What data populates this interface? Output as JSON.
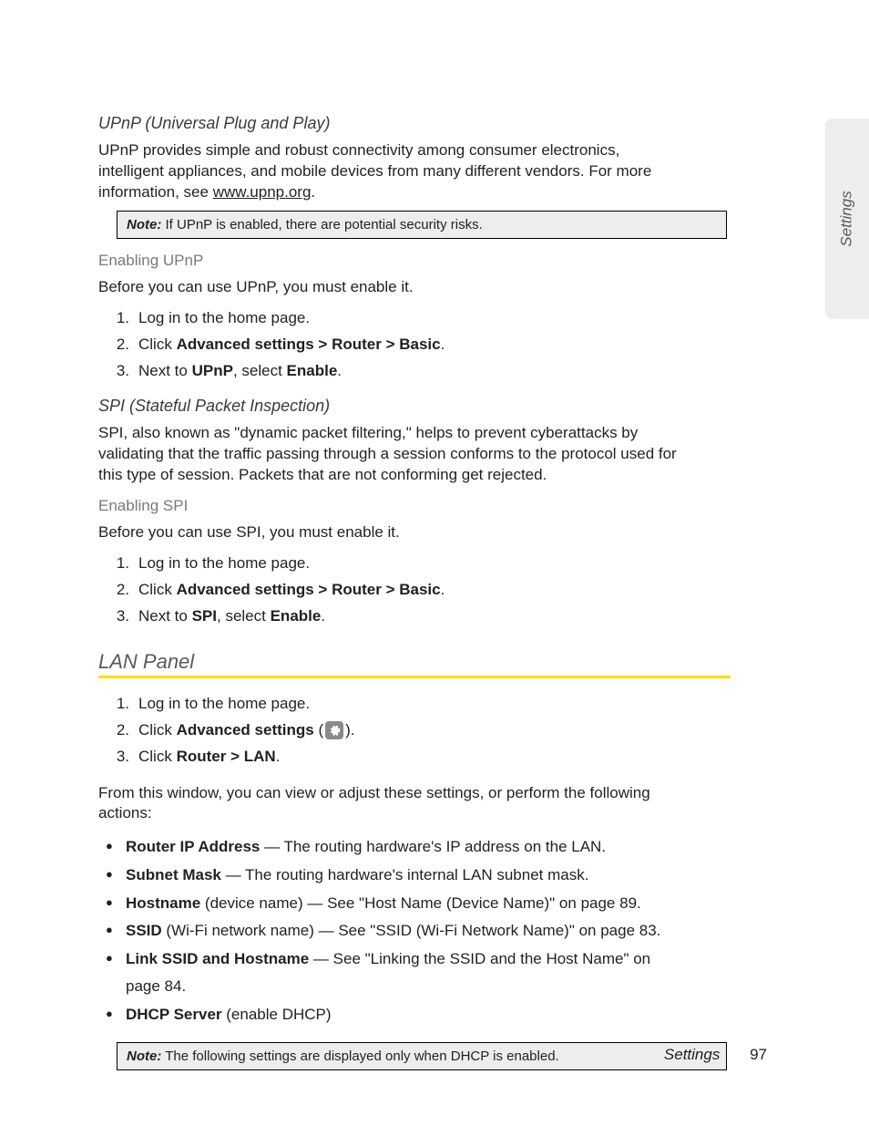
{
  "sideTab": "Settings",
  "upnp": {
    "heading": "UPnP (Universal Plug and Play)",
    "intro1": "UPnP provides simple and robust connectivity among consumer electronics, intelligent appliances, and mobile devices from many different vendors. For more information, see ",
    "link": "www.upnp.org",
    "intro2": ".",
    "noteLabel": "Note:",
    "noteText": "If UPnP is enabled, there are potential security risks.",
    "enableHeading": "Enabling UPnP",
    "enableIntro": "Before you can use UPnP, you must enable it.",
    "step1": "Log in to the home page.",
    "step2a": "Click ",
    "step2b": "Advanced settings > Router > Basic",
    "step2c": ".",
    "step3a": "Next to ",
    "step3b": "UPnP",
    "step3c": ", select ",
    "step3d": "Enable",
    "step3e": "."
  },
  "spi": {
    "heading": "SPI (Stateful Packet Inspection)",
    "intro": "SPI, also known as \"dynamic packet filtering,\" helps to prevent cyberattacks by validating that the traffic passing through a session conforms to the protocol used for this type of session. Packets that are not conforming get rejected.",
    "enableHeading": "Enabling SPI",
    "enableIntro": "Before you can use SPI, you must enable it.",
    "step1": "Log in to the home page.",
    "step2a": "Click ",
    "step2b": "Advanced settings > Router > Basic",
    "step2c": ".",
    "step3a": "Next to ",
    "step3b": "SPI",
    "step3c": ", select ",
    "step3d": "Enable",
    "step3e": "."
  },
  "lan": {
    "heading": "LAN Panel",
    "step1": "Log in to the home page.",
    "step2a": "Click ",
    "step2b": "Advanced settings",
    "step2c": " (",
    "step2d": ").",
    "step3a": "Click ",
    "step3b": "Router > LAN",
    "step3c": ".",
    "outro": "From this window, you can view or adjust these settings, or perform the following actions:",
    "b1a": "Router IP Address",
    "b1b": " — The routing hardware's IP address on the LAN.",
    "b2a": "Subnet Mask",
    "b2b": " — The routing hardware's internal LAN subnet mask.",
    "b3a": "Hostname",
    "b3b": " (device name) — See \"Host Name (Device Name)\" on page 89.",
    "b4a": "SSID",
    "b4b": " (Wi-Fi network name) — See \"SSID (Wi-Fi Network Name)\" on page 83.",
    "b5a": "Link SSID and Hostname",
    "b5b": " — See \"Linking the SSID and the Host Name\" on page 84.",
    "b6a": "DHCP Server",
    "b6b": " (enable DHCP)",
    "noteLabel": "Note:",
    "noteText": "The following settings are displayed only when DHCP is enabled."
  },
  "footer": {
    "section": "Settings",
    "page": "97"
  }
}
